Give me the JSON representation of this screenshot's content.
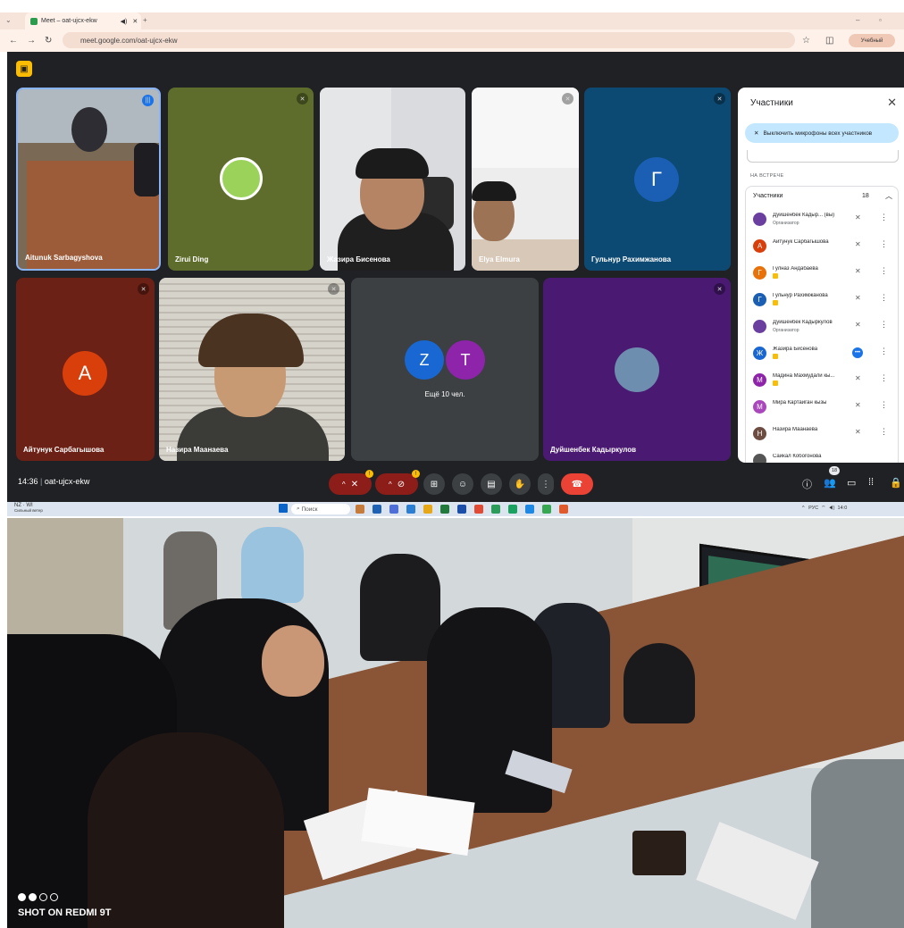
{
  "browser": {
    "tab_title": "Meet – oat-ujcx-ekw",
    "url": "meet.google.com/oat-ujcx-ekw",
    "profile_label": "Учебный",
    "back_icon": "arrow-left-icon",
    "forward_icon": "arrow-right-icon",
    "reload_icon": "reload-icon"
  },
  "meet": {
    "tiles": [
      {
        "name": "Aitunuk Sarbagyshova",
        "kind": "video",
        "speaking": true
      },
      {
        "name": "Zirui Ding",
        "kind": "avatar-image"
      },
      {
        "name": "Жазира Бисенова",
        "kind": "video"
      },
      {
        "name": "Elya Elmura",
        "kind": "video"
      },
      {
        "name": "Гульнур Рахимжанова",
        "kind": "avatar",
        "letter": "Г",
        "color": "#1a5fb4"
      },
      {
        "name": "Айтунук Сарбагышова",
        "kind": "avatar",
        "letter": "A",
        "color": "#d93f0b"
      },
      {
        "name": "Назира Маанаева",
        "kind": "video"
      },
      {
        "name": "Ещё 10 чел.",
        "kind": "more",
        "letters": [
          "Z",
          "T"
        ]
      },
      {
        "name": "Дуйшенбек Кадыркулов",
        "kind": "avatar-image"
      }
    ],
    "panel": {
      "title": "Участники",
      "mute_all": "Выключить микрофоны всех участников",
      "section": "НА ВСТРЕЧЕ",
      "group_label": "Участники",
      "group_count": "18",
      "participants": [
        {
          "name": "Дуйшенбек Кадыр... (вы)",
          "role": "Организатор",
          "letter": "",
          "color": "#6a3fa0"
        },
        {
          "name": "Айтунук Сарбагышова",
          "role": "",
          "letter": "A",
          "color": "#d93f0b"
        },
        {
          "name": "Гулназ Андабаева",
          "role": "",
          "letter": "Г",
          "color": "#e8710a"
        },
        {
          "name": "Гульнур Рахимжанова",
          "role": "",
          "letter": "Г",
          "color": "#1a5fb4"
        },
        {
          "name": "Дуйшенбек Кадыркулов",
          "role": "Организатор",
          "letter": "",
          "color": "#6a3fa0"
        },
        {
          "name": "Жазира Бисенова",
          "role": "",
          "letter": "Ж",
          "color": "#1967d2"
        },
        {
          "name": "Мадина Махмудали кы...",
          "role": "",
          "letter": "М",
          "color": "#8e24aa"
        },
        {
          "name": "Мира Картайган кызы",
          "role": "",
          "letter": "М",
          "color": "#ab47bc"
        },
        {
          "name": "Назира Маанаева",
          "role": "",
          "letter": "Н",
          "color": "#6d4c41"
        },
        {
          "name": "Сайкал Кобогонова",
          "role": "",
          "letter": "",
          "color": "#555555"
        }
      ]
    },
    "bottom": {
      "time": "14:36",
      "code": "oat-ujcx-ekw",
      "people_count": "18"
    }
  },
  "taskbar": {
    "weather": "NZ · WI",
    "weather_sub": "Сильный ветер",
    "search": "Поиск",
    "tray": "РУС",
    "clock": "14:0"
  },
  "photo": {
    "caption": "SHOT ON REDMI 9T"
  }
}
